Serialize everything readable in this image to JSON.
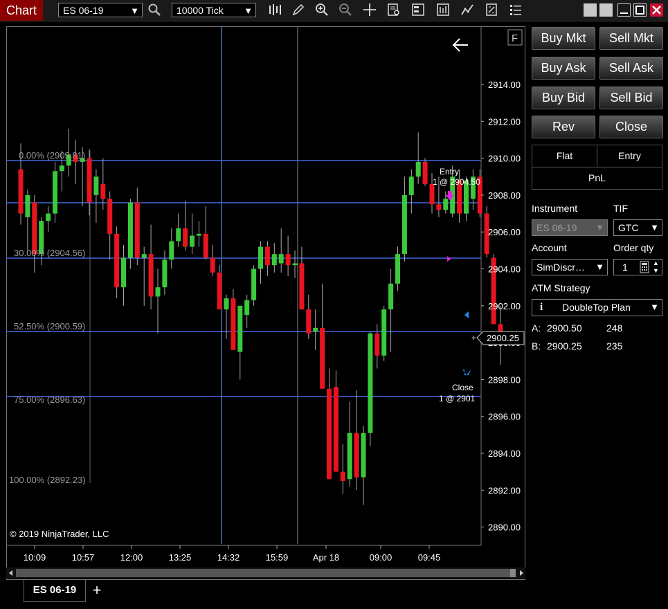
{
  "app": {
    "title": "Chart"
  },
  "toolbar": {
    "instrument": "ES 06-19",
    "interval": "10000 Tick"
  },
  "chart": {
    "copyright": "© 2019 NinjaTrader, LLC",
    "flag_button": "F",
    "price_ticks": [
      "2914.00",
      "2912.00",
      "2910.00",
      "2908.00",
      "2906.00",
      "2904.00",
      "2902.00",
      "2900.00",
      "2898.00",
      "2896.00",
      "2894.00",
      "2892.00",
      "2890.00"
    ],
    "last_price": "2900.25",
    "time_ticks": [
      "10:09",
      "10:57",
      "12:00",
      "13:25",
      "14:32",
      "15:59",
      "Apr 18",
      "09:00",
      "09:45"
    ],
    "fib_labels": [
      "0.00% (2909.81)",
      "30.00% (2904.56)",
      "52.50% (2900.59)",
      "75.00% (2896.63)",
      "100.00% (2892.23)"
    ],
    "entry_label_1": "Entry",
    "entry_label_2": "1 @ 2904.50",
    "close_label_1": "Close",
    "close_label_2": "1 @ 2901",
    "colors": {
      "up": "#3cc83c",
      "down": "#e8141e",
      "fib_line": "#4169e1",
      "crosshair": "#5a7fd6"
    }
  },
  "chart_data": {
    "type": "candlestick",
    "ylim": [
      2889.5,
      2916.5
    ],
    "candles": [
      {
        "o": 2909.4,
        "h": 2910.8,
        "l": 2906.4,
        "c": 2907.0
      },
      {
        "o": 2906.8,
        "h": 2908.3,
        "l": 2905.0,
        "c": 2908.0
      },
      {
        "o": 2907.6,
        "h": 2908.0,
        "l": 2903.8,
        "c": 2904.8
      },
      {
        "o": 2904.8,
        "h": 2906.8,
        "l": 2904.2,
        "c": 2906.6
      },
      {
        "o": 2906.6,
        "h": 2907.4,
        "l": 2906.0,
        "c": 2907.0
      },
      {
        "o": 2907.0,
        "h": 2909.8,
        "l": 2906.5,
        "c": 2909.3
      },
      {
        "o": 2909.3,
        "h": 2910.4,
        "l": 2908.2,
        "c": 2909.6
      },
      {
        "o": 2909.6,
        "h": 2911.6,
        "l": 2909.0,
        "c": 2910.2
      },
      {
        "o": 2910.2,
        "h": 2911.0,
        "l": 2908.6,
        "c": 2909.8
      },
      {
        "o": 2909.8,
        "h": 2910.6,
        "l": 2907.4,
        "c": 2910.0
      },
      {
        "o": 2910.0,
        "h": 2910.5,
        "l": 2906.9,
        "c": 2907.6
      },
      {
        "o": 2908.0,
        "h": 2909.4,
        "l": 2906.5,
        "c": 2909.0
      },
      {
        "o": 2908.6,
        "h": 2910.0,
        "l": 2907.2,
        "c": 2907.8
      },
      {
        "o": 2907.8,
        "h": 2908.2,
        "l": 2904.5,
        "c": 2905.9
      },
      {
        "o": 2905.9,
        "h": 2906.3,
        "l": 2902.4,
        "c": 2903.0
      },
      {
        "o": 2903.0,
        "h": 2905.3,
        "l": 2902.0,
        "c": 2904.6
      },
      {
        "o": 2904.6,
        "h": 2907.8,
        "l": 2904.0,
        "c": 2907.6
      },
      {
        "o": 2907.6,
        "h": 2908.4,
        "l": 2904.2,
        "c": 2904.6
      },
      {
        "o": 2904.6,
        "h": 2905.2,
        "l": 2902.0,
        "c": 2904.8
      },
      {
        "o": 2904.8,
        "h": 2906.4,
        "l": 2901.8,
        "c": 2902.5
      },
      {
        "o": 2902.5,
        "h": 2904.0,
        "l": 2900.5,
        "c": 2903.0
      },
      {
        "o": 2903.0,
        "h": 2905.0,
        "l": 2902.6,
        "c": 2904.5
      },
      {
        "o": 2904.5,
        "h": 2906.2,
        "l": 2904.0,
        "c": 2905.5
      },
      {
        "o": 2905.5,
        "h": 2907.0,
        "l": 2905.2,
        "c": 2906.2
      },
      {
        "o": 2906.2,
        "h": 2907.7,
        "l": 2905.0,
        "c": 2905.2
      },
      {
        "o": 2905.2,
        "h": 2907.0,
        "l": 2904.8,
        "c": 2905.8
      },
      {
        "o": 2905.8,
        "h": 2906.6,
        "l": 2905.2,
        "c": 2905.9
      },
      {
        "o": 2905.9,
        "h": 2907.4,
        "l": 2904.5,
        "c": 2904.6
      },
      {
        "o": 2904.6,
        "h": 2905.3,
        "l": 2903.6,
        "c": 2903.8
      },
      {
        "o": 2903.8,
        "h": 2904.2,
        "l": 2901.8,
        "c": 2901.8
      },
      {
        "o": 2901.8,
        "h": 2902.6,
        "l": 2900.2,
        "c": 2902.4
      },
      {
        "o": 2902.4,
        "h": 2902.9,
        "l": 2899.6,
        "c": 2899.6
      },
      {
        "o": 2899.5,
        "h": 2902.0,
        "l": 2898.0,
        "c": 2902.0
      },
      {
        "o": 2901.5,
        "h": 2902.6,
        "l": 2900.8,
        "c": 2902.3
      },
      {
        "o": 2902.3,
        "h": 2904.2,
        "l": 2902.0,
        "c": 2904.0
      },
      {
        "o": 2904.0,
        "h": 2905.5,
        "l": 2903.2,
        "c": 2905.2
      },
      {
        "o": 2905.2,
        "h": 2905.5,
        "l": 2903.6,
        "c": 2904.2
      },
      {
        "o": 2904.2,
        "h": 2905.4,
        "l": 2903.8,
        "c": 2904.8
      },
      {
        "o": 2904.3,
        "h": 2906.2,
        "l": 2903.8,
        "c": 2904.8
      },
      {
        "o": 2904.8,
        "h": 2905.8,
        "l": 2903.6,
        "c": 2904.2
      },
      {
        "o": 2904.2,
        "h": 2905.0,
        "l": 2903.5,
        "c": 2904.3
      },
      {
        "o": 2904.3,
        "h": 2905.2,
        "l": 2901.8,
        "c": 2901.8
      },
      {
        "o": 2901.8,
        "h": 2902.6,
        "l": 2900.2,
        "c": 2900.5
      },
      {
        "o": 2900.6,
        "h": 2901.8,
        "l": 2899.6,
        "c": 2900.8
      },
      {
        "o": 2900.8,
        "h": 2903.2,
        "l": 2897.5,
        "c": 2897.5
      },
      {
        "o": 2897.5,
        "h": 2898.6,
        "l": 2892.6,
        "c": 2892.6
      },
      {
        "o": 2897.6,
        "h": 2898.5,
        "l": 2893.0,
        "c": 2893.0
      },
      {
        "o": 2893.0,
        "h": 2894.5,
        "l": 2891.8,
        "c": 2892.5
      },
      {
        "o": 2892.6,
        "h": 2896.8,
        "l": 2892.2,
        "c": 2895.1
      },
      {
        "o": 2895.1,
        "h": 2897.4,
        "l": 2892.0,
        "c": 2892.7
      },
      {
        "o": 2892.7,
        "h": 2895.5,
        "l": 2891.2,
        "c": 2895.1
      },
      {
        "o": 2895.1,
        "h": 2900.6,
        "l": 2894.4,
        "c": 2900.5
      },
      {
        "o": 2900.5,
        "h": 2901.0,
        "l": 2898.6,
        "c": 2899.3
      },
      {
        "o": 2899.3,
        "h": 2902.0,
        "l": 2899.0,
        "c": 2901.8
      },
      {
        "o": 2901.8,
        "h": 2904.0,
        "l": 2899.5,
        "c": 2903.2
      },
      {
        "o": 2903.2,
        "h": 2905.2,
        "l": 2902.8,
        "c": 2904.8
      },
      {
        "o": 2904.8,
        "h": 2909.0,
        "l": 2904.4,
        "c": 2908.0
      },
      {
        "o": 2908.0,
        "h": 2909.4,
        "l": 2907.0,
        "c": 2909.0
      },
      {
        "o": 2909.0,
        "h": 2911.4,
        "l": 2908.6,
        "c": 2909.8
      },
      {
        "o": 2909.8,
        "h": 2910.0,
        "l": 2908.5,
        "c": 2908.6
      },
      {
        "o": 2908.6,
        "h": 2909.2,
        "l": 2907.0,
        "c": 2907.5
      },
      {
        "o": 2907.5,
        "h": 2909.0,
        "l": 2906.8,
        "c": 2907.2
      },
      {
        "o": 2907.2,
        "h": 2908.2,
        "l": 2907.0,
        "c": 2907.8
      },
      {
        "o": 2907.0,
        "h": 2909.6,
        "l": 2906.8,
        "c": 2909.0
      },
      {
        "o": 2908.8,
        "h": 2909.4,
        "l": 2906.5,
        "c": 2907.0
      },
      {
        "o": 2907.0,
        "h": 2909.0,
        "l": 2906.6,
        "c": 2908.8
      },
      {
        "o": 2907.8,
        "h": 2909.4,
        "l": 2907.2,
        "c": 2909.0
      },
      {
        "o": 2909.0,
        "h": 2909.4,
        "l": 2906.8,
        "c": 2907.0
      },
      {
        "o": 2907.0,
        "h": 2907.4,
        "l": 2904.6,
        "c": 2904.8
      },
      {
        "o": 2904.6,
        "h": 2904.8,
        "l": 2901.0,
        "c": 2901.0
      },
      {
        "o": 2901.0,
        "h": 2902.0,
        "l": 2898.8,
        "c": 2900.2
      }
    ]
  },
  "panel": {
    "buttons": {
      "buy_mkt": "Buy Mkt",
      "sell_mkt": "Sell Mkt",
      "buy_ask": "Buy Ask",
      "sell_ask": "Sell Ask",
      "buy_bid": "Buy Bid",
      "sell_bid": "Sell Bid",
      "rev": "Rev",
      "close": "Close"
    },
    "position": {
      "flat": "Flat",
      "entry": "Entry",
      "pnl": "PnL"
    },
    "instrument_label": "Instrument",
    "instrument_value": "ES 06-19",
    "tif_label": "TIF",
    "tif_value": "GTC",
    "account_label": "Account",
    "account_value": "SimDiscr…",
    "qty_label": "Order qty",
    "qty_value": "1",
    "atm_label": "ATM Strategy",
    "atm_value": "DoubleTop Plan",
    "atm_icon": "i",
    "ask": {
      "label": "A:",
      "price": "2900.50",
      "size": "248"
    },
    "bid": {
      "label": "B:",
      "price": "2900.25",
      "size": "235"
    }
  },
  "tabs": {
    "active": "ES 06-19",
    "add": "+"
  }
}
